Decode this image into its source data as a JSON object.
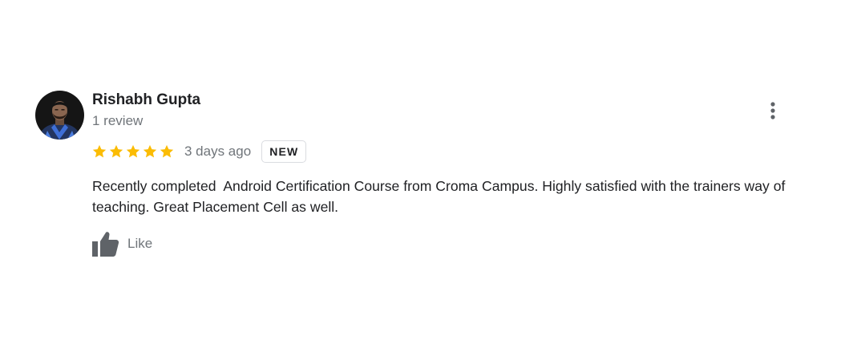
{
  "review": {
    "author_name": "Rishabh Gupta",
    "author_review_count": "1 review",
    "rating": 5,
    "rating_max": 5,
    "time_ago": "3 days ago",
    "badge": "NEW",
    "text": "Recently completed  Android Certification Course from Croma Campus. Highly satisfied with the trainers way of teaching. Great Placement Cell as well.",
    "like_label": "Like"
  },
  "icons": {
    "menu": "more-vert-icon",
    "like": "thumb-up-icon",
    "star": "star-icon"
  },
  "colors": {
    "star": "#fbbc04",
    "text_primary": "#202124",
    "text_secondary": "#70757a",
    "icon": "#5f6368",
    "badge_border": "#dadce0"
  }
}
